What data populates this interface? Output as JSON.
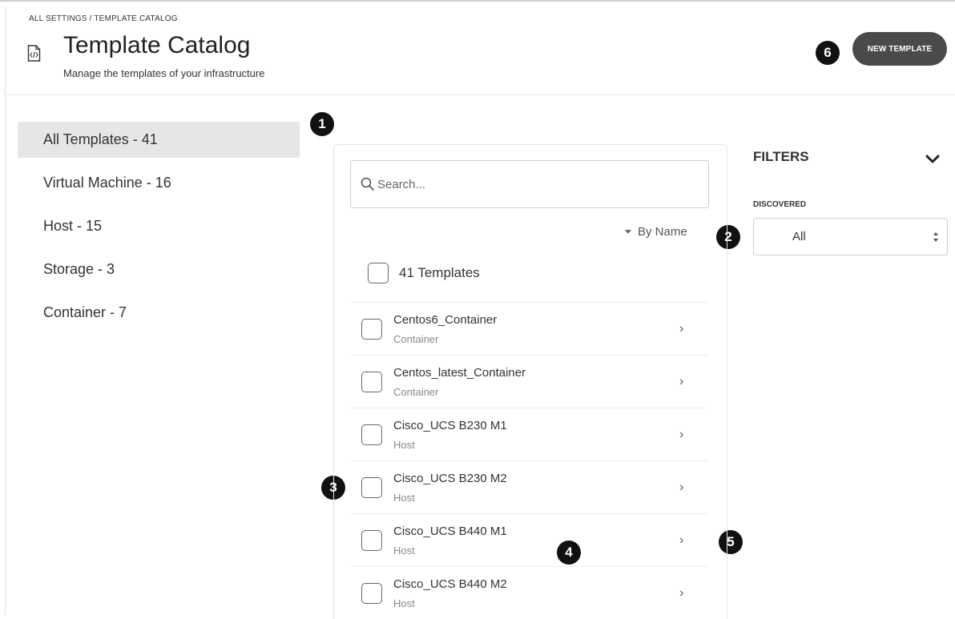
{
  "breadcrumb": "ALL SETTINGS / TEMPLATE CATALOG",
  "header": {
    "title": "Template Catalog",
    "subtitle": "Manage the templates of your infrastructure",
    "icon": "code-file-icon",
    "new_template_label": "NEW TEMPLATE"
  },
  "callouts": [
    "1",
    "2",
    "3",
    "4",
    "5",
    "6"
  ],
  "sidebar": {
    "items": [
      {
        "label": "All Templates - 41",
        "active": true
      },
      {
        "label": "Virtual Machine - 16",
        "active": false
      },
      {
        "label": "Host - 15",
        "active": false
      },
      {
        "label": "Storage - 3",
        "active": false
      },
      {
        "label": "Container - 7",
        "active": false
      }
    ]
  },
  "search": {
    "placeholder": "Search...",
    "value": ""
  },
  "sort": {
    "label": "By Name"
  },
  "list": {
    "count_label": "41 Templates",
    "rows": [
      {
        "name": "Centos6_Container",
        "type": "Container"
      },
      {
        "name": "Centos_latest_Container",
        "type": "Container"
      },
      {
        "name": "Cisco_UCS B230 M1",
        "type": "Host"
      },
      {
        "name": "Cisco_UCS B230 M2",
        "type": "Host"
      },
      {
        "name": "Cisco_UCS B440 M1",
        "type": "Host"
      },
      {
        "name": "Cisco_UCS B440 M2",
        "type": "Host"
      }
    ],
    "chevron": "›"
  },
  "filters": {
    "title": "FILTERS",
    "discovered_label": "DISCOVERED",
    "discovered_value": "All"
  },
  "colors": {
    "button_bg": "#4a4a4a",
    "active_item_bg": "#e6e6e6",
    "callout_bg": "#111111"
  }
}
